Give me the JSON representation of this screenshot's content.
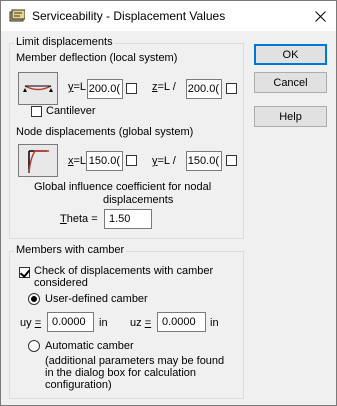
{
  "window": {
    "title": "Serviceability - Displacement Values"
  },
  "buttons": {
    "ok": "OK",
    "cancel": "Cancel",
    "help": "Help"
  },
  "limit": {
    "group_label": "Limit displacements",
    "member_label": "Member deflection (local system)",
    "y_prefix": "y",
    "y_suffix": "=L /",
    "y_value": "200.0(",
    "z_prefix": "z",
    "z_suffix": "=L /",
    "z_value": "200.0(",
    "cantilever": "Cantilever",
    "node_label": "Node displacements (global system)",
    "x_prefix": "x",
    "x_suffix": "=L /",
    "x_value": "150.0(",
    "y2_prefix": "y",
    "y2_suffix": "=L /",
    "y2_value": "150.0(",
    "coef_line1": "Global influence coefficient for nodal",
    "coef_line2": "displacements",
    "theta_prefix": "T",
    "theta_suffix": "heta =",
    "theta_value": "1.50"
  },
  "camber": {
    "group_label": "Members with camber",
    "check_line1": "Check of displacements with camber",
    "check_line2": "considered",
    "user_defined": "User-defined camber",
    "uy_label": "uy",
    "uy_eq": "=",
    "uy_value": "0.0000",
    "uy_unit": "in",
    "uz_label": "uz",
    "uz_eq": "=",
    "uz_value": "0.0000",
    "uz_unit": "in",
    "automatic": "Automatic camber",
    "note_line1": "(additional parameters may be found",
    "note_line2": "in the dialog box for calculation",
    "note_line3": "configuration)"
  }
}
